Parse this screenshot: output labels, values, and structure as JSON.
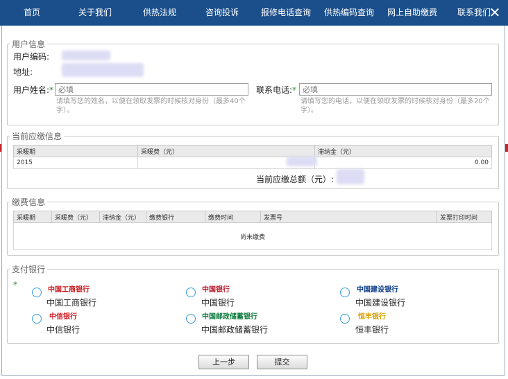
{
  "nav": {
    "items": [
      "首页",
      "关于我们",
      "供热法规",
      "咨询投诉",
      "报修电话查询",
      "供热编码查询",
      "网上自助缴费",
      "联系我们"
    ],
    "close": "✕"
  },
  "user_info": {
    "legend": "用户信息",
    "code_label": "用户编码:",
    "address_label": "地址:",
    "name_label": "用户姓名:",
    "name_placeholder": "必填",
    "name_hint": "请填写您的姓名，以便在领取发票的时候核对身份（最多40个字）。",
    "phone_label": "联系电话:",
    "phone_placeholder": "必填",
    "phone_hint": "请填写您的电话，以便在领取发票的时候核对身份（最多20个字）。",
    "required_mark": "*"
  },
  "current_due": {
    "legend": "当前应缴信息",
    "headers": [
      "采暖期",
      "采暖费（元）",
      "滞纳金（元）"
    ],
    "rows": [
      [
        "2015",
        "",
        "0.00"
      ]
    ],
    "total_label": "当前应缴总额（元）:"
  },
  "payment_info": {
    "legend": "缴费信息",
    "headers": [
      "采暖期",
      "采暖费（元）",
      "滞纳金（元）",
      "缴费银行",
      "缴费时间",
      "发票号",
      "发票打印时间"
    ],
    "empty_text": "尚未缴费"
  },
  "banks": {
    "legend": "支付银行",
    "required_mark": "*",
    "items": [
      {
        "name": "中国工商银行",
        "logo": "中国工商银行",
        "logo_color": "#c8161d",
        "icon": "icbc-logo-icon"
      },
      {
        "name": "中国银行",
        "logo": "中国银行",
        "logo_color": "#b4162a",
        "icon": "boc-logo-icon"
      },
      {
        "name": "中国建设银行",
        "logo": "中国建设银行",
        "logo_color": "#0a3b87",
        "icon": "ccb-logo-icon"
      },
      {
        "name": "中信银行",
        "logo": "中信银行",
        "logo_color": "#d21e24",
        "icon": "citic-logo-icon"
      },
      {
        "name": "中国邮政储蓄银行",
        "logo": "中国邮政储蓄银行",
        "logo_color": "#0b7a3b",
        "icon": "psbc-logo-icon"
      },
      {
        "name": "恒丰银行",
        "logo": "恒丰银行",
        "logo_color": "#d8a000",
        "icon": "hfbank-logo-icon"
      }
    ]
  },
  "buttons": {
    "prev": "上一步",
    "submit": "提交"
  },
  "colors": {
    "nav_bg": "#1b4f8c",
    "radio_border": "#3aa0d8",
    "required": "#2e8b2e"
  }
}
